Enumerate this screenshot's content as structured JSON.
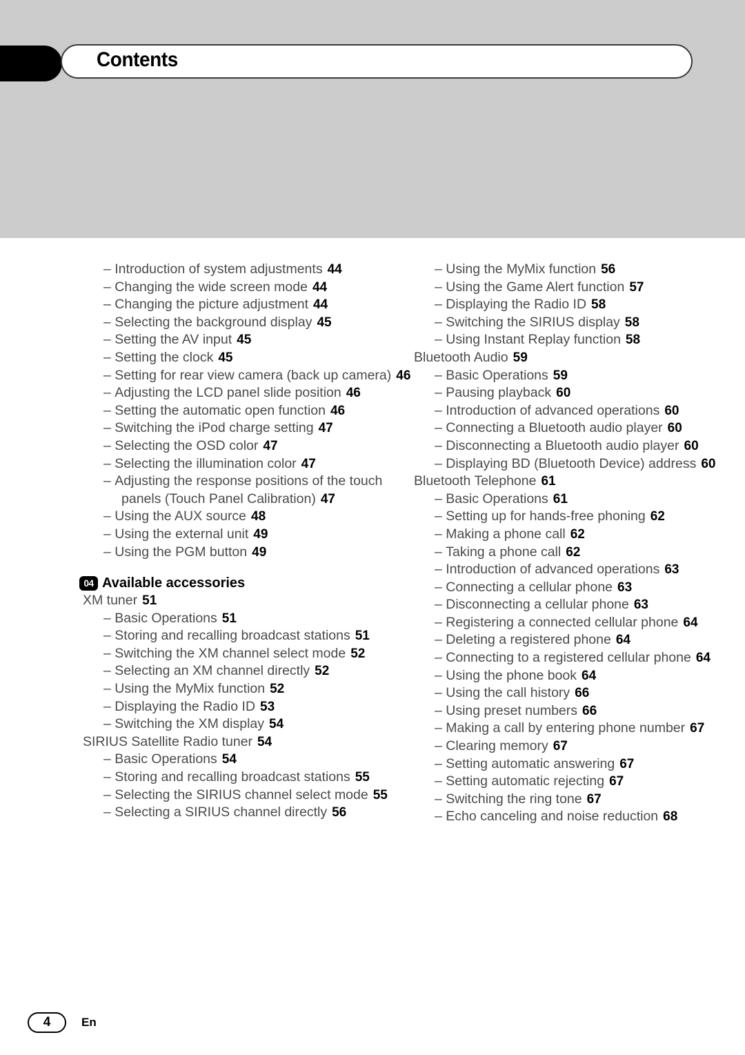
{
  "header": {
    "title": "Contents",
    "tab_icon": "black-tab-marker"
  },
  "footer": {
    "page_number": "4",
    "language": "En"
  },
  "columns": {
    "left": [
      {
        "level": 2,
        "text": "Introduction of system adjustments",
        "page": "44"
      },
      {
        "level": 2,
        "text": "Changing the wide screen mode",
        "page": "44"
      },
      {
        "level": 2,
        "text": "Changing the picture adjustment",
        "page": "44"
      },
      {
        "level": 2,
        "text": "Selecting the background display",
        "page": "45"
      },
      {
        "level": 2,
        "text": "Setting the AV input",
        "page": "45"
      },
      {
        "level": 2,
        "text": "Setting the clock",
        "page": "45"
      },
      {
        "level": 2,
        "text": "Setting for rear view camera (back up camera)",
        "page": "46"
      },
      {
        "level": 2,
        "text": "Adjusting the LCD panel slide position",
        "page": "46"
      },
      {
        "level": 2,
        "text": "Setting the automatic open function",
        "page": "46"
      },
      {
        "level": 2,
        "text": "Switching the iPod charge setting",
        "page": "47"
      },
      {
        "level": 2,
        "text": "Selecting the OSD color",
        "page": "47"
      },
      {
        "level": 2,
        "text": "Selecting the illumination color",
        "page": "47"
      },
      {
        "level": 2,
        "text": "Adjusting the response positions of the touch panels (Touch Panel Calibration)",
        "page": "47"
      },
      {
        "level": 2,
        "text": "Using the AUX source",
        "page": "48"
      },
      {
        "level": 2,
        "text": "Using the external unit",
        "page": "49"
      },
      {
        "level": 2,
        "text": "Using the PGM button",
        "page": "49"
      },
      {
        "level": 0,
        "badge": "04",
        "text": "Available accessories"
      },
      {
        "level": 1,
        "text": "XM tuner",
        "page": "51"
      },
      {
        "level": 2,
        "text": "Basic Operations",
        "page": "51"
      },
      {
        "level": 2,
        "text": "Storing and recalling broadcast stations",
        "page": "51"
      },
      {
        "level": 2,
        "text": "Switching the XM channel select mode",
        "page": "52"
      },
      {
        "level": 2,
        "text": "Selecting an XM channel directly",
        "page": "52"
      },
      {
        "level": 2,
        "text": "Using the MyMix function",
        "page": "52"
      },
      {
        "level": 2,
        "text": "Displaying the Radio ID",
        "page": "53"
      },
      {
        "level": 2,
        "text": "Switching the XM display",
        "page": "54"
      },
      {
        "level": 1,
        "text": "SIRIUS Satellite Radio tuner",
        "page": "54"
      },
      {
        "level": 2,
        "text": "Basic Operations",
        "page": "54"
      },
      {
        "level": 2,
        "text": "Storing and recalling broadcast stations",
        "page": "55"
      },
      {
        "level": 2,
        "text": "Selecting the SIRIUS channel select mode",
        "page": "55"
      },
      {
        "level": 2,
        "text": "Selecting a SIRIUS channel directly",
        "page": "56"
      }
    ],
    "right": [
      {
        "level": 2,
        "text": "Using the MyMix function",
        "page": "56"
      },
      {
        "level": 2,
        "text": "Using the Game Alert function",
        "page": "57"
      },
      {
        "level": 2,
        "text": "Displaying the Radio ID",
        "page": "58"
      },
      {
        "level": 2,
        "text": "Switching the SIRIUS display",
        "page": "58"
      },
      {
        "level": 2,
        "text": "Using Instant Replay function",
        "page": "58"
      },
      {
        "level": 1,
        "text": "Bluetooth Audio",
        "page": "59"
      },
      {
        "level": 2,
        "text": "Basic Operations",
        "page": "59"
      },
      {
        "level": 2,
        "text": "Pausing playback",
        "page": "60"
      },
      {
        "level": 2,
        "text": "Introduction of advanced operations",
        "page": "60"
      },
      {
        "level": 2,
        "text": "Connecting a Bluetooth audio player",
        "page": "60"
      },
      {
        "level": 2,
        "text": "Disconnecting a Bluetooth audio player",
        "page": "60"
      },
      {
        "level": 2,
        "text": "Displaying BD (Bluetooth Device) address",
        "page": "60"
      },
      {
        "level": 1,
        "text": "Bluetooth Telephone",
        "page": "61"
      },
      {
        "level": 2,
        "text": "Basic Operations",
        "page": "61"
      },
      {
        "level": 2,
        "text": "Setting up for hands-free phoning",
        "page": "62"
      },
      {
        "level": 2,
        "text": "Making a phone call",
        "page": "62"
      },
      {
        "level": 2,
        "text": "Taking a phone call",
        "page": "62"
      },
      {
        "level": 2,
        "text": "Introduction of advanced operations",
        "page": "63"
      },
      {
        "level": 2,
        "text": "Connecting a cellular phone",
        "page": "63"
      },
      {
        "level": 2,
        "text": "Disconnecting a cellular phone",
        "page": "63"
      },
      {
        "level": 2,
        "text": "Registering a connected cellular phone",
        "page": "64"
      },
      {
        "level": 2,
        "text": "Deleting a registered phone",
        "page": "64"
      },
      {
        "level": 2,
        "text": "Connecting to a registered cellular phone",
        "page": "64"
      },
      {
        "level": 2,
        "text": "Using the phone book",
        "page": "64"
      },
      {
        "level": 2,
        "text": "Using the call history",
        "page": "66"
      },
      {
        "level": 2,
        "text": "Using preset numbers",
        "page": "66"
      },
      {
        "level": 2,
        "text": "Making a call by entering phone number",
        "page": "67"
      },
      {
        "level": 2,
        "text": "Clearing memory",
        "page": "67"
      },
      {
        "level": 2,
        "text": "Setting automatic answering",
        "page": "67"
      },
      {
        "level": 2,
        "text": "Setting automatic rejecting",
        "page": "67"
      },
      {
        "level": 2,
        "text": "Switching the ring tone",
        "page": "67"
      },
      {
        "level": 2,
        "text": "Echo canceling and noise reduction",
        "page": "68"
      }
    ]
  }
}
